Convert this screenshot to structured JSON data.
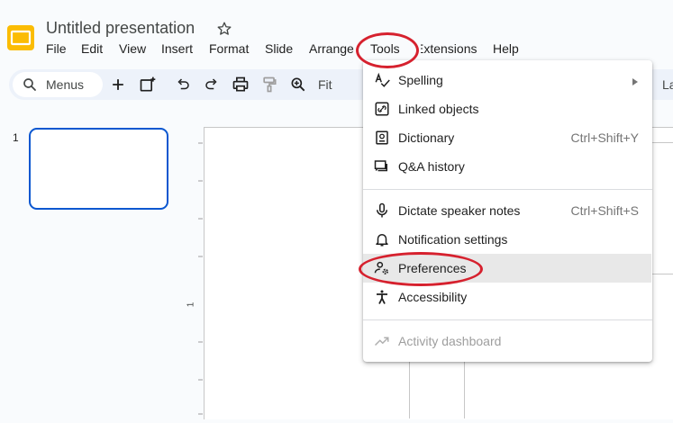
{
  "header": {
    "title": "Untitled presentation",
    "menu": [
      "File",
      "Edit",
      "View",
      "Insert",
      "Format",
      "Slide",
      "Arrange",
      "Tools",
      "Extensions",
      "Help"
    ]
  },
  "toolbar": {
    "search_label": "Menus",
    "zoom_label": "Fit",
    "layout_partial": "La",
    "icons": [
      "search-icon",
      "add-icon",
      "new-slide-icon",
      "undo-icon",
      "redo-icon",
      "print-icon",
      "paint-format-icon",
      "zoom-icon"
    ]
  },
  "filmstrip": {
    "slide_number": "1"
  },
  "ruler": {
    "mark": "1"
  },
  "tools_menu": {
    "items": [
      {
        "label": "Spelling",
        "icon": "spelling-icon",
        "submenu": true
      },
      {
        "label": "Linked objects",
        "icon": "linked-objects-icon"
      },
      {
        "label": "Dictionary",
        "icon": "dictionary-icon",
        "shortcut": "Ctrl+Shift+Y"
      },
      {
        "label": "Q&A history",
        "icon": "qa-history-icon"
      },
      {
        "label": "Dictate speaker notes",
        "icon": "microphone-icon",
        "shortcut": "Ctrl+Shift+S"
      },
      {
        "label": "Notification settings",
        "icon": "bell-icon"
      },
      {
        "label": "Preferences",
        "icon": "preferences-icon",
        "highlighted": true
      },
      {
        "label": "Accessibility",
        "icon": "accessibility-icon"
      },
      {
        "label": "Activity dashboard",
        "icon": "activity-icon",
        "disabled": true
      }
    ]
  },
  "annotations": {
    "color": "#d6212e",
    "circled": [
      "Tools",
      "Preferences"
    ]
  },
  "colors": {
    "accent": "#0b57d0",
    "logo": "#fbbc04",
    "toolbar_bg": "#edf2fa"
  }
}
